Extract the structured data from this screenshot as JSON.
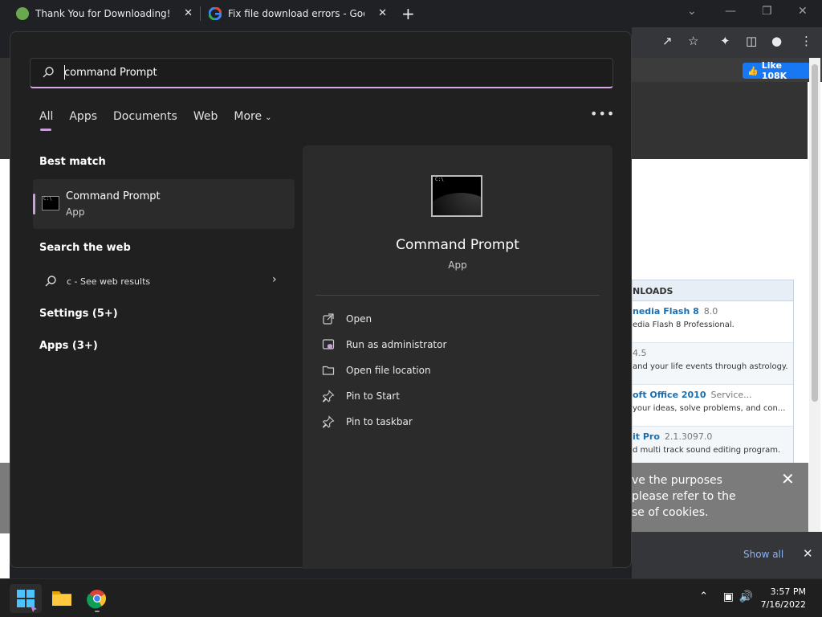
{
  "browser": {
    "tabs": [
      {
        "title": "Thank You for Downloading!"
      },
      {
        "title": "Fix file download errors - Google Chrome Help"
      }
    ],
    "new_tab": "+",
    "tab_close": "✕"
  },
  "webpage": {
    "fb_like": "Like 108K",
    "downloads_header": "NLOADS",
    "items": [
      {
        "title": "nedia Flash 8",
        "version": "8.0",
        "desc": "edia Flash 8 Professional."
      },
      {
        "title": "",
        "version": "4.5",
        "desc": "and your life events through astrology."
      },
      {
        "title": "oft Office 2010",
        "version": "Service...",
        "desc": "your ideas, solve problems, and con..."
      },
      {
        "title": "it Pro",
        "version": "2.1.3097.0",
        "desc": "d multi track sound editing program."
      }
    ],
    "cookie_lines": [
      "ve the purposes",
      " please refer to the",
      "se of cookies."
    ],
    "show_all": "Show all"
  },
  "search": {
    "query": "command Prompt",
    "filters": [
      "All",
      "Apps",
      "Documents",
      "Web",
      "More"
    ],
    "more_options": "•••",
    "best_match_header": "Best match",
    "best_match": {
      "title": "Command Prompt",
      "subtitle": "App"
    },
    "search_web_header": "Search the web",
    "web_result": "c - See web results",
    "settings_header": "Settings (5+)",
    "apps_header": "Apps (3+)"
  },
  "detail": {
    "title": "Command Prompt",
    "subtitle": "App",
    "actions": [
      {
        "label": "Open",
        "icon": "open-external-icon"
      },
      {
        "label": "Run as administrator",
        "icon": "shield-admin-icon"
      },
      {
        "label": "Open file location",
        "icon": "folder-icon"
      },
      {
        "label": "Pin to Start",
        "icon": "pin-icon"
      },
      {
        "label": "Pin to taskbar",
        "icon": "pin-icon"
      }
    ]
  },
  "taskbar": {
    "time": "3:57 PM",
    "date": "7/16/2022"
  },
  "colors": {
    "accent": "#c9a0dc",
    "panel": "#202020",
    "card": "#2b2b2b",
    "link": "#1a6fb3"
  }
}
